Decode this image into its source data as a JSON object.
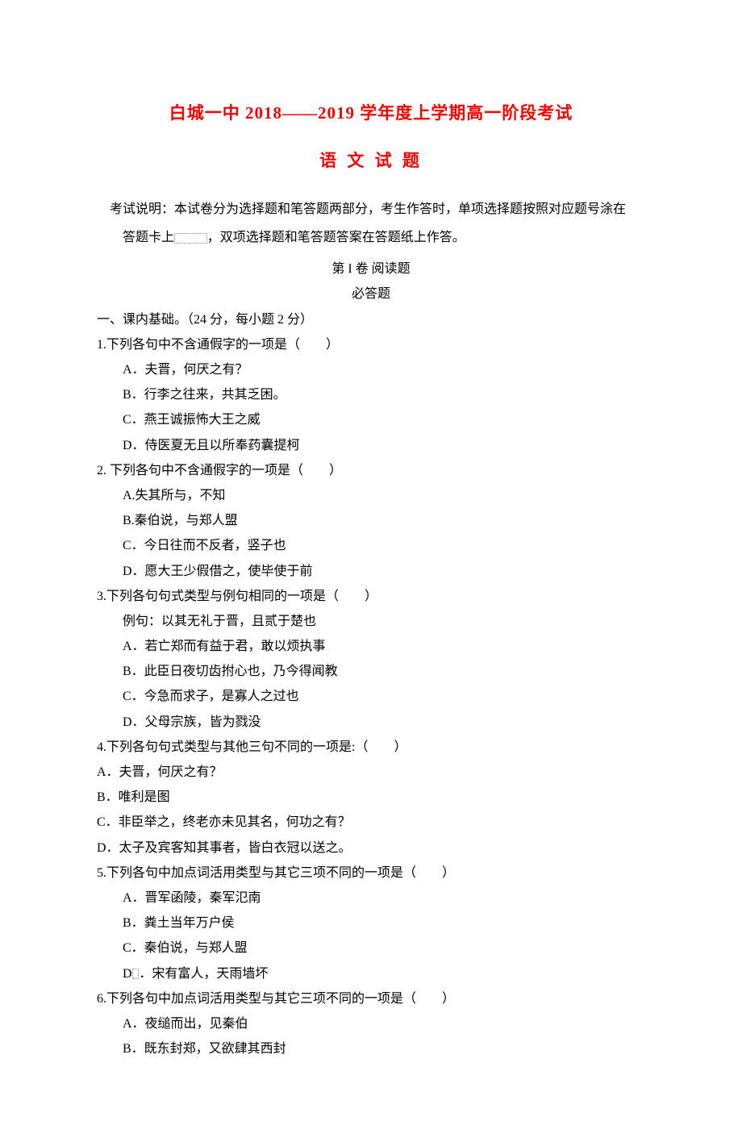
{
  "title": "白城一中 2018——2019 学年度上学期高一阶段考试",
  "subject": "语 文 试 题",
  "instruction_line1": "考试说明：本试卷分为选择题和笔答题两部分，考生作答时，单项选择题按照对应题号涂在",
  "instruction_line2_a": "答题卡上",
  "instruction_line2_b": "，双项选择题和笔答题答案在答题纸上作答。",
  "volume_label": "第 I 卷  阅读题",
  "must_answer": "必答题",
  "section1": "一、课内基础。（24 分，每小题 2 分）",
  "q1": {
    "stem": "1.下列各句中不含通假字的一项是（　　）",
    "A": "A．夫晋，何厌之有？",
    "B": "B．行李之往来，共其乏困。",
    "C": "C．燕王诚振怖大王之威",
    "D": "D．侍医夏无且以所奉药囊提柯"
  },
  "q2": {
    "stem": "2. 下列各句中不含通假字的一项是（　　）",
    "A": "A.失其所与，不知",
    "B": "B.秦伯说，与郑人盟",
    "C": "C．今日往而不反者，竖子也",
    "D": "D．愿大王少假借之，使毕使于前"
  },
  "q3": {
    "stem": "3.下列各句句式类型与例句相同的一项是（　　）",
    "example": "例句：以其无礼于晋，且贰于楚也",
    "A": "A．若亡郑而有益于君，敢以烦执事",
    "B": "B．此臣日夜切齿拊心也，乃今得闻教",
    "C": "C．今急而求子，是寡人之过也",
    "D": "D．父母宗族，皆为戮没"
  },
  "q4": {
    "stem": "4.下列各句句式类型与其他三句不同的一项是:（　　）",
    "A": "A．夫晋，何厌之有？",
    "B": "B．唯利是图",
    "C": "C．非臣举之，终老亦未见其名，何功之有？",
    "D": "D．太子及宾客知其事者，皆白衣冠以送之。"
  },
  "q5": {
    "stem": "5.下列各句中加点词活用类型与其它三项不同的一项是（　　）",
    "A": "A．晋军函陵，秦军氾南",
    "B": "B．粪土当年万户侯",
    "C": "C．秦伯说，与郑人盟",
    "D_a": "D",
    "D_b": "．宋有富人，天雨墙坏"
  },
  "q6": {
    "stem": "6.下列各句中加点词活用类型与其它三项不同的一项是（　　）",
    "A": "A．夜缒而出，见秦伯",
    "B": "B．既东封郑，又欲肆其西封"
  }
}
